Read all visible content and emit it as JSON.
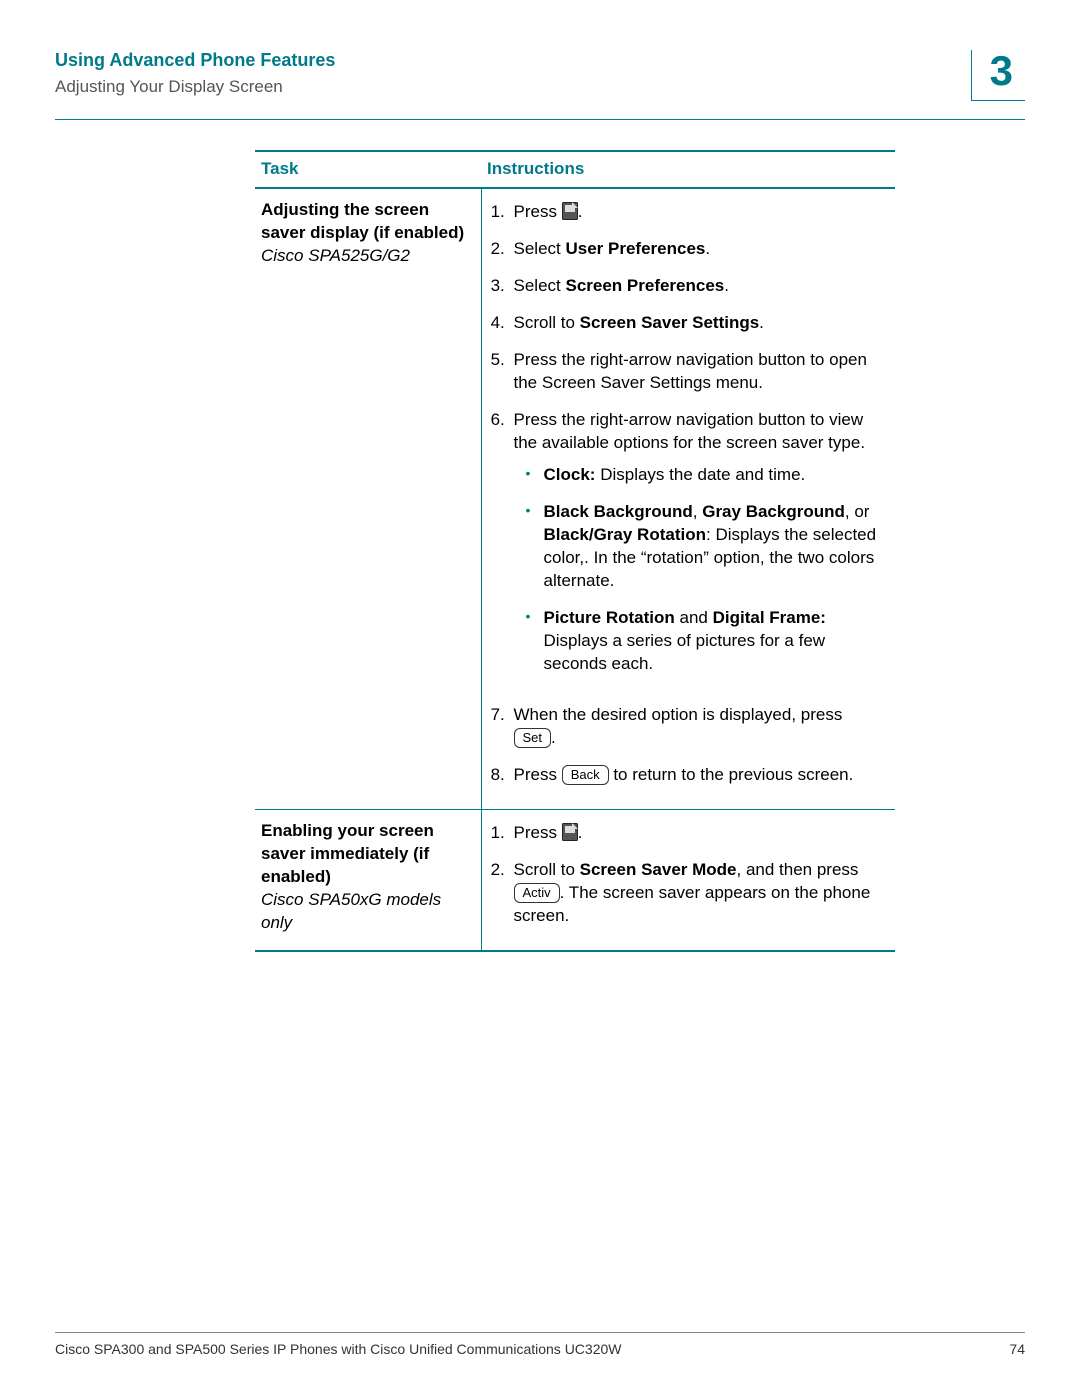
{
  "header": {
    "chapter_title": "Using Advanced Phone Features",
    "section_title": "Adjusting Your Display Screen",
    "chapter_number": "3"
  },
  "table": {
    "col_task": "Task",
    "col_instructions": "Instructions",
    "rows": [
      {
        "task_name": "Adjusting the screen saver display (if enabled)",
        "task_model": "Cisco SPA525G/G2",
        "steps": {
          "s1_prefix": "Press ",
          "s1_suffix": ".",
          "s2_prefix": "Select ",
          "s2_bold": "User Preferences",
          "s2_suffix": ".",
          "s3_prefix": "Select ",
          "s3_bold": "Screen Preferences",
          "s3_suffix": ".",
          "s4_prefix": "Scroll to ",
          "s4_bold": "Screen Saver Settings",
          "s4_suffix": ".",
          "s5": "Press the right-arrow navigation button to open the Screen Saver Settings menu.",
          "s6": "Press the right-arrow navigation button to view the available options for the screen saver type.",
          "bullets": {
            "b1_bold": "Clock:",
            "b1_text": " Displays the date and time.",
            "b2_bold1": "Black Background",
            "b2_mid1": ", ",
            "b2_bold2": "Gray Background",
            "b2_mid2": ", or ",
            "b2_bold3": "Black/Gray Rotation",
            "b2_text": ": Displays the selected color,. In the “rotation” option, the two colors alternate.",
            "b3_bold1": "Picture Rotation",
            "b3_mid": " and ",
            "b3_bold2": "Digital Frame:",
            "b3_text": " Displays a series of pictures for a few seconds each."
          },
          "s7_prefix": "When the desired option is displayed, press ",
          "s7_key": "Set",
          "s7_suffix": ".",
          "s8_prefix": "Press ",
          "s8_key": "Back",
          "s8_suffix": " to return to the previous screen."
        }
      },
      {
        "task_name": "Enabling your screen saver immediately (if enabled)",
        "task_model": "Cisco SPA50xG models only",
        "steps": {
          "s1_prefix": "Press ",
          "s1_suffix": ".",
          "s2_prefix": "Scroll to ",
          "s2_bold": "Screen Saver Mode",
          "s2_mid": ", and then press ",
          "s2_key": "Activ",
          "s2_suffix": ". The screen saver appears on the phone screen."
        }
      }
    ]
  },
  "footer": {
    "book_title": "Cisco SPA300 and SPA500 Series IP Phones with Cisco Unified Communications UC320W",
    "page_number": "74"
  }
}
